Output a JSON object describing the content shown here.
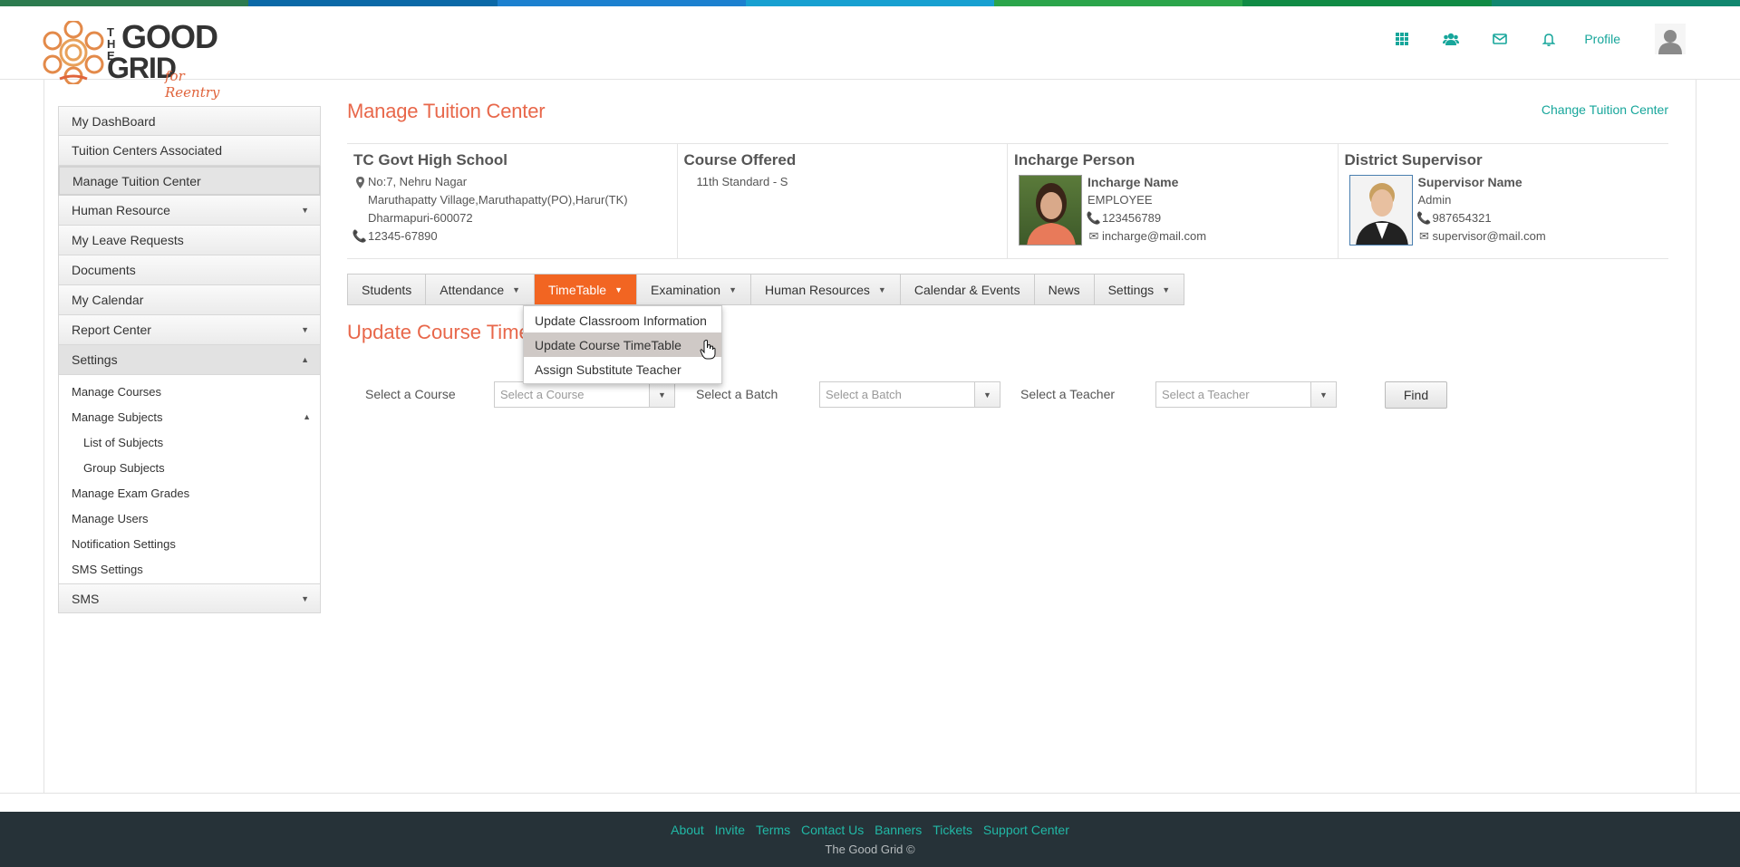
{
  "header": {
    "logo": {
      "the": "THE",
      "good": "GOOD",
      "grid": "GRID",
      "tagline": "for Reentry"
    },
    "icons": [
      "apps-grid-icon",
      "users-icon",
      "mail-icon",
      "bell-icon"
    ],
    "profile_label": "Profile",
    "strip_colors": [
      "#2e7a4e",
      "#0a6aa8",
      "#1d7fcf",
      "#179fd0",
      "#2aa44a",
      "#0f8a44",
      "#10876f"
    ]
  },
  "sidebar": {
    "items": [
      {
        "label": "My DashBoard"
      },
      {
        "label": "Tuition Centers Associated"
      },
      {
        "label": "Manage Tuition Center",
        "active": true
      },
      {
        "label": "Human Resource",
        "caret": "▼"
      },
      {
        "label": "My Leave Requests"
      },
      {
        "label": "Documents"
      },
      {
        "label": "My Calendar"
      },
      {
        "label": "Report Center",
        "caret": "▼"
      },
      {
        "label": "Settings",
        "caret": "▲",
        "expanded": true
      }
    ],
    "settings_sub": [
      {
        "label": "Manage Courses"
      },
      {
        "label": "Manage Subjects",
        "caret": "▲"
      },
      {
        "label": "List of Subjects"
      },
      {
        "label": "Group Subjects"
      },
      {
        "label": "Manage Exam Grades"
      },
      {
        "label": "Manage Users"
      },
      {
        "label": "Notification Settings"
      },
      {
        "label": "SMS Settings"
      }
    ],
    "sms": {
      "label": "SMS",
      "caret": "▼"
    }
  },
  "main": {
    "title": "Manage Tuition Center",
    "change_link": "Change Tuition Center",
    "center": {
      "name": "TC Govt High School",
      "address1": "No:7, Nehru Nagar",
      "address2": "Maruthapatty Village,Maruthapatty(PO),Harur(TK)",
      "address3": "Dharmapuri-600072",
      "phone": "12345-67890"
    },
    "course": {
      "heading": "Course Offered",
      "value": "11th Standard - S"
    },
    "incharge": {
      "heading": "Incharge Person",
      "name": "Incharge Name",
      "role": "EMPLOYEE",
      "phone": "123456789",
      "email": "incharge@mail.com"
    },
    "supervisor": {
      "heading": "District Supervisor",
      "name": "Supervisor Name",
      "role": "Admin",
      "phone": "987654321",
      "email": "supervisor@mail.com"
    },
    "tabs": [
      {
        "label": "Students"
      },
      {
        "label": "Attendance",
        "caret": "▼"
      },
      {
        "label": "TimeTable",
        "caret": "▼",
        "active": true
      },
      {
        "label": "Examination",
        "caret": "▼"
      },
      {
        "label": "Human Resources",
        "caret": "▼"
      },
      {
        "label": "Calendar & Events"
      },
      {
        "label": "News"
      },
      {
        "label": "Settings",
        "caret": "▼"
      }
    ],
    "dropdown": [
      {
        "label": "Update Classroom Information"
      },
      {
        "label": "Update Course TimeTable",
        "hover": true
      },
      {
        "label": "Assign Substitute Teacher"
      }
    ],
    "section_title": "Update Course TimeTable",
    "filters": {
      "course_label": "Select a Course",
      "course_placeholder": "Select a Course",
      "batch_label": "Select a Batch",
      "batch_placeholder": "Select a Batch",
      "teacher_label": "Select a Teacher",
      "teacher_placeholder": "Select a Teacher",
      "find_label": "Find"
    }
  },
  "footer": {
    "links": [
      "About",
      "Invite",
      "Terms",
      "Contact Us",
      "Banners",
      "Tickets",
      "Support Center"
    ],
    "copyright": "The Good Grid ©"
  }
}
